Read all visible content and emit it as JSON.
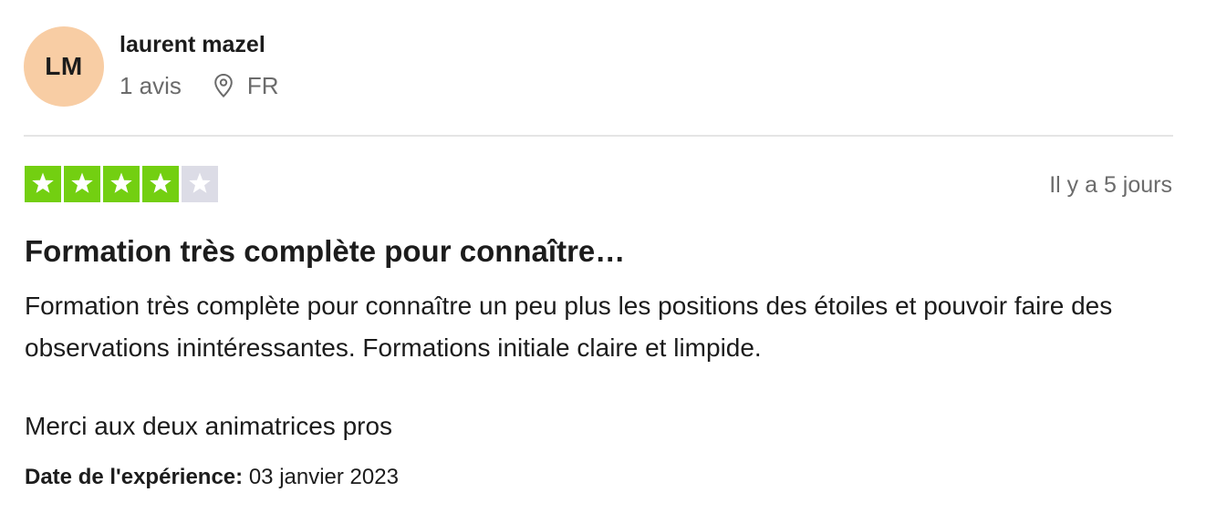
{
  "reviewer": {
    "initials": "LM",
    "name": "laurent mazel",
    "review_count": "1 avis",
    "country": "FR",
    "avatar_color": "#f8cda4"
  },
  "rating": {
    "stars": 4,
    "max": 5,
    "filled_color": "#73cf11",
    "empty_color": "#dcdce6",
    "date_relative": "Il y a 5 jours"
  },
  "review": {
    "title": "Formation très complète pour connaître…",
    "body_paragraph_1": "Formation très complète pour connaître un peu plus les positions des étoiles et pouvoir faire des observations inintéressantes. Formations initiale claire et limpide.",
    "body_paragraph_2": "Merci aux deux animatrices pros"
  },
  "experience": {
    "label": "Date de l'expérience:",
    "date": "03 janvier 2023"
  },
  "icons": {
    "location": "location-pin-icon",
    "star": "star-icon"
  }
}
